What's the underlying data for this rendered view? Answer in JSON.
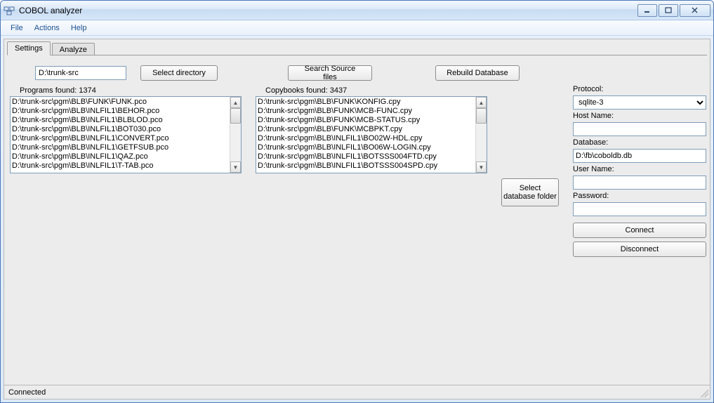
{
  "window": {
    "title": "COBOL analyzer"
  },
  "menu": {
    "file": "File",
    "actions": "Actions",
    "help": "Help"
  },
  "tabs": {
    "settings": "Settings",
    "analyze": "Analyze"
  },
  "top": {
    "src_dir": "D:\\trunk-src",
    "select_dir_btn": "Select directory",
    "search_btn": "Search Source files",
    "rebuild_btn": "Rebuild Database"
  },
  "programs": {
    "label": "Programs found: 1374",
    "items": [
      "D:\\trunk-src\\pgm\\BLB\\FUNK\\FUNK.pco",
      "D:\\trunk-src\\pgm\\BLB\\INLFIL1\\BEHOR.pco",
      "D:\\trunk-src\\pgm\\BLB\\INLFIL1\\BLBLOD.pco",
      "D:\\trunk-src\\pgm\\BLB\\INLFIL1\\BOT030.pco",
      "D:\\trunk-src\\pgm\\BLB\\INLFIL1\\CONVERT.pco",
      "D:\\trunk-src\\pgm\\BLB\\INLFIL1\\GETFSUB.pco",
      "D:\\trunk-src\\pgm\\BLB\\INLFIL1\\QAZ.pco",
      "D:\\trunk-src\\pgm\\BLB\\INLFIL1\\T-TAB.pco"
    ]
  },
  "copybooks": {
    "label": "Copybooks found: 3437",
    "items": [
      "D:\\trunk-src\\pgm\\BLB\\FUNK\\KONFIG.cpy",
      "D:\\trunk-src\\pgm\\BLB\\FUNK\\MCB-FUNC.cpy",
      "D:\\trunk-src\\pgm\\BLB\\FUNK\\MCB-STATUS.cpy",
      "D:\\trunk-src\\pgm\\BLB\\FUNK\\MCBPKT.cpy",
      "D:\\trunk-src\\pgm\\BLB\\INLFIL1\\BO02W-HDL.cpy",
      "D:\\trunk-src\\pgm\\BLB\\INLFIL1\\BO06W-LOGIN.cpy",
      "D:\\trunk-src\\pgm\\BLB\\INLFIL1\\BOTSSS004FTD.cpy",
      "D:\\trunk-src\\pgm\\BLB\\INLFIL1\\BOTSSS004SPD.cpy"
    ]
  },
  "dbfolder": {
    "btn_line1": "Select",
    "btn_line2": "database folder"
  },
  "conn": {
    "protocol_label": "Protocol:",
    "protocol_value": "sqlite-3",
    "host_label": "Host Name:",
    "host_value": "",
    "database_label": "Database:",
    "database_value": "D:\\fb\\coboldb.db",
    "user_label": "User Name:",
    "user_value": "",
    "pass_label": "Password:",
    "pass_value": "",
    "connect_btn": "Connect",
    "disconnect_btn": "Disconnect"
  },
  "status": {
    "text": "Connected"
  }
}
